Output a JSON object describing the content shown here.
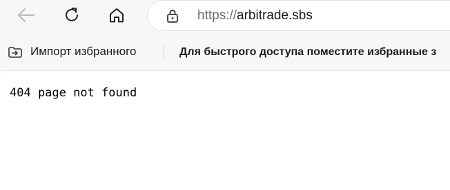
{
  "toolbar": {
    "back_icon": "arrow-left-icon",
    "refresh_icon": "refresh-icon",
    "home_icon": "home-icon"
  },
  "address_bar": {
    "lock_icon": "lock-icon",
    "url_scheme": "https://",
    "url_host": "arbitrade.sbs"
  },
  "favorites_bar": {
    "import_icon": "import-favorites-icon",
    "import_label": "Импорт избранного",
    "hint": "Для быстрого доступа поместите избранные з"
  },
  "page": {
    "error_text": "404 page not found"
  },
  "colors": {
    "chrome_bg": "#f7f7f7",
    "page_bg": "#ffffff",
    "text": "#1b1b1b",
    "muted": "#6b6b6b"
  }
}
